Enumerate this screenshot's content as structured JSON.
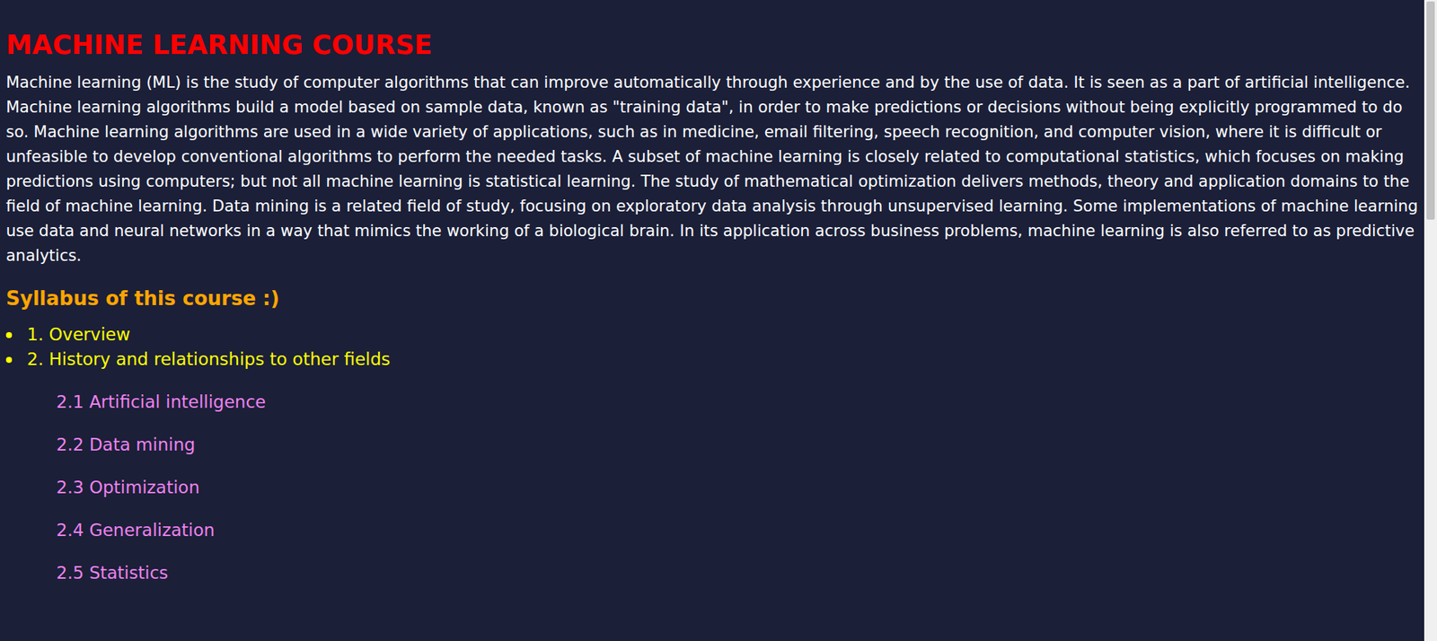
{
  "page": {
    "title": "MACHINE LEARNING COURSE",
    "intro": "Machine learning (ML) is the study of computer algorithms that can improve automatically through experience and by the use of data. It is seen as a part of artificial intelligence. Machine learning algorithms build a model based on sample data, known as \"training data\", in order to make predictions or decisions without being explicitly programmed to do so. Machine learning algorithms are used in a wide variety of applications, such as in medicine, email filtering, speech recognition, and computer vision, where it is difficult or unfeasible to develop conventional algorithms to perform the needed tasks. A subset of machine learning is closely related to computational statistics, which focuses on making predictions using computers; but not all machine learning is statistical learning. The study of mathematical optimization delivers methods, theory and application domains to the field of machine learning. Data mining is a related field of study, focusing on exploratory data analysis through unsupervised learning. Some implementations of machine learning use data and neural networks in a way that mimics the working of a biological brain. In its application across business problems, machine learning is also referred to as predictive analytics.",
    "syllabus_heading": "Syllabus of this course :)"
  },
  "syllabus": [
    {
      "label": "1. Overview",
      "subitems": []
    },
    {
      "label": "2. History and relationships to other fields",
      "subitems": [
        "2.1 Artificial intelligence",
        "2.2 Data mining",
        "2.3 Optimization",
        "2.4 Generalization",
        "2.5 Statistics"
      ]
    }
  ],
  "scrollbar": {
    "level": 0.34
  }
}
